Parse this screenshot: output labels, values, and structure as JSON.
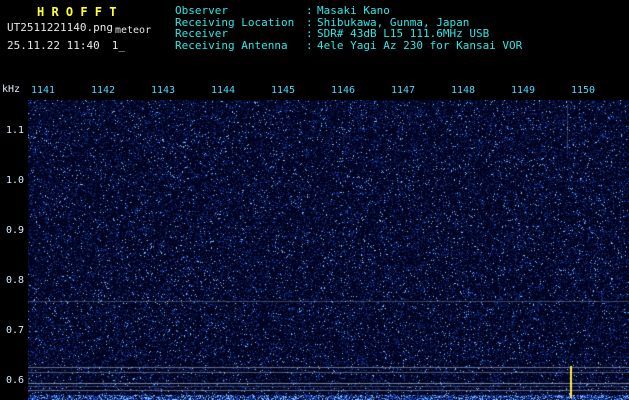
{
  "header": {
    "app_title": "H R O F F T",
    "filename": "UT2511221140.png",
    "mode_label": "meteor",
    "datetime": "25.11.22 11:40",
    "counter": "1_",
    "separator": ":",
    "info": [
      {
        "label": "Observer",
        "value": "Masaki Kano"
      },
      {
        "label": "Receiving Location",
        "value": "Shibukawa, Gunma, Japan"
      },
      {
        "label": "Receiver",
        "value": "SDR# 43dB L15 111.6MHz USB"
      },
      {
        "label": "Receiving Antenna",
        "value": "4ele Yagi Az 230 for Kansai VOR"
      }
    ]
  },
  "spectrogram": {
    "y_axis_unit": "kHz",
    "y_ticks": [
      "1.1",
      "1.0",
      "0.9",
      "0.8",
      "0.7",
      "0.6"
    ],
    "x_ticks": [
      "1141",
      "1142",
      "1143",
      "1144",
      "1145",
      "1146",
      "1147",
      "1148",
      "1149",
      "1150"
    ]
  },
  "colors": {
    "title": "#ffff33",
    "file_text": "#e6e6e6",
    "info_text": "#2ee6e6",
    "axis_text": "#4fd8ff",
    "tick_text": "#d8ecff",
    "plot_background": "#000420",
    "noise_dim": "#0c2060",
    "noise_mid": "#1c4cc0",
    "noise_bright": "#86c2ff",
    "signal_line": "#aab4c8",
    "marker": "#ffe94a"
  }
}
